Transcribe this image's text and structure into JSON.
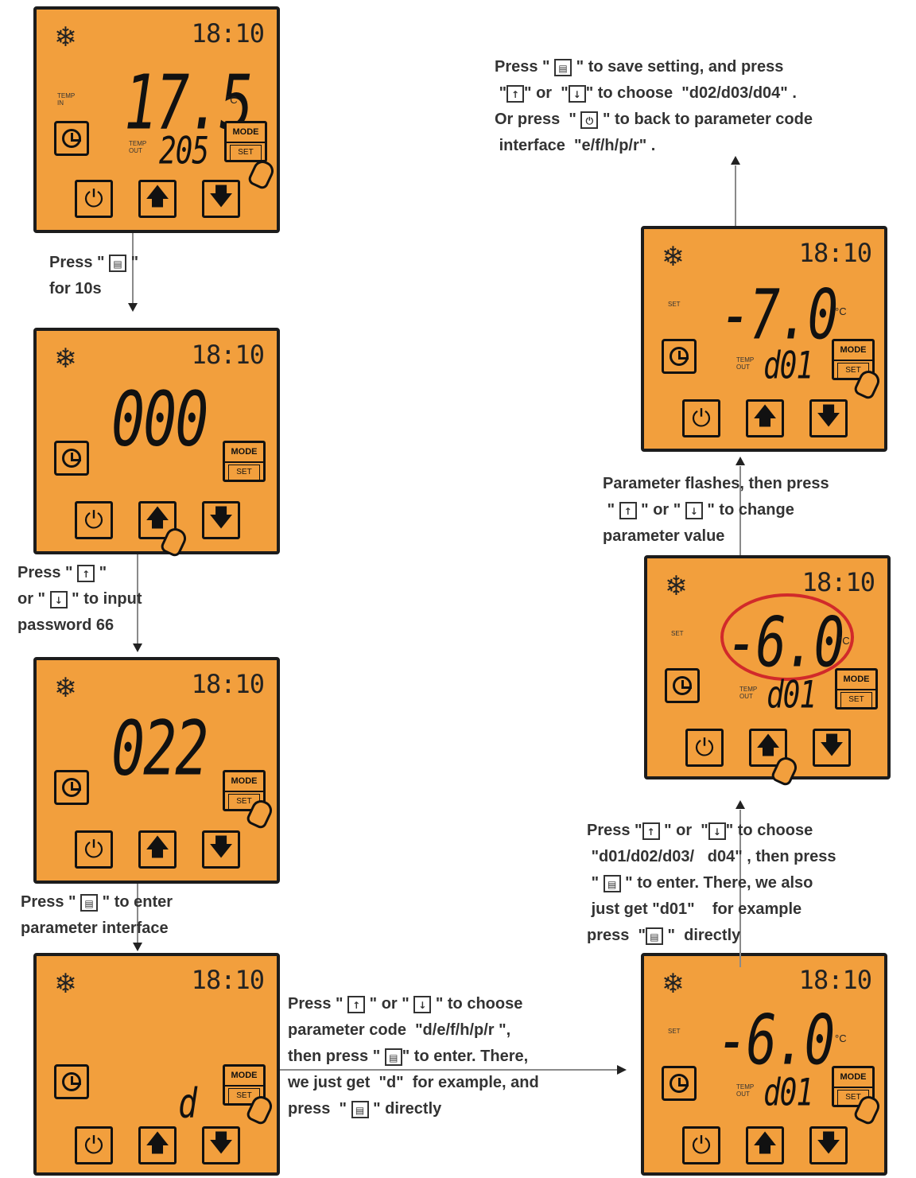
{
  "panels": {
    "p1": {
      "main": "17.5",
      "sub": "205",
      "unit": "°C",
      "label_in": "TEMP\nIN",
      "label_out": "TEMP\nOUT",
      "clock": "18:10"
    },
    "p2": {
      "main": "000",
      "clock": "18:10"
    },
    "p3": {
      "main": "022",
      "clock": "18:10"
    },
    "p4": {
      "main": "d",
      "clock": "18:10"
    },
    "p5": {
      "main": "-6.0",
      "sub": "d01",
      "unit": "°C",
      "set": "SET",
      "label_out": "TEMP\nOUT",
      "clock": "18:10"
    },
    "p6": {
      "main": "-6.0",
      "sub": "d01",
      "unit": "°C",
      "set": "SET",
      "label_out": "TEMP\nOUT",
      "clock": "18:10"
    },
    "p7": {
      "main": "-7.0",
      "sub": "d01",
      "unit": "°C",
      "set": "SET",
      "label_out": "TEMP\nOUT",
      "clock": "18:10"
    }
  },
  "buttons": {
    "mode": "MODE",
    "set": "SET",
    "power": "⏻",
    "up": "🡅",
    "down": "🡇"
  },
  "icons": {
    "snowflake": "snowflake-icon",
    "timer": "timer-icon",
    "hand": "hand-icon",
    "key_up": "up-key-icon",
    "key_down": "down-key-icon",
    "key_mode": "mode-set-key-icon",
    "key_power": "power-key-icon"
  },
  "notes": {
    "n1": [
      "Press \" ",
      " \"",
      "for 10s"
    ],
    "n2": [
      "Press \" ",
      " \"",
      "or \" ",
      " \" to input",
      "password 66"
    ],
    "n3": [
      "Press \" ",
      " \" to enter",
      "parameter interface"
    ],
    "n4": [
      "Press \" ",
      " \" or \" ",
      " \" to choose",
      "parameter code  \"d/e/f/h/p/r \",",
      "then press \" ",
      "\" to enter. There,",
      "we just get  \"d\"  for example, and",
      "press  \" ",
      " \" directly"
    ],
    "n5": [
      "Press \"",
      " \" or  \"",
      "\" to choose",
      "\"d01/d02/d03/   d04\" , then press",
      "\" ",
      " \" to enter. There, we also",
      "just get \"d01\"    for example",
      "press  \"",
      " \"  directly"
    ],
    "n6": [
      "Parameter flashes, then press",
      "\" ",
      " \" or \" ",
      " \" to change",
      "parameter value"
    ],
    "n7": [
      "Press \" ",
      " \" to save setting, and press",
      "\"",
      "\" or  \"",
      "\" to choose  \"d02/d03/d04\" .",
      "Or press  \" ",
      " \" to back to parameter code",
      "interface  \"e/f/h/p/r\" ."
    ]
  },
  "key_labels": {
    "mode_set": "MODE SET"
  },
  "colors": {
    "panel": "#f29f3d",
    "border": "#1c1c1c",
    "highlight": "#d12a2a"
  }
}
